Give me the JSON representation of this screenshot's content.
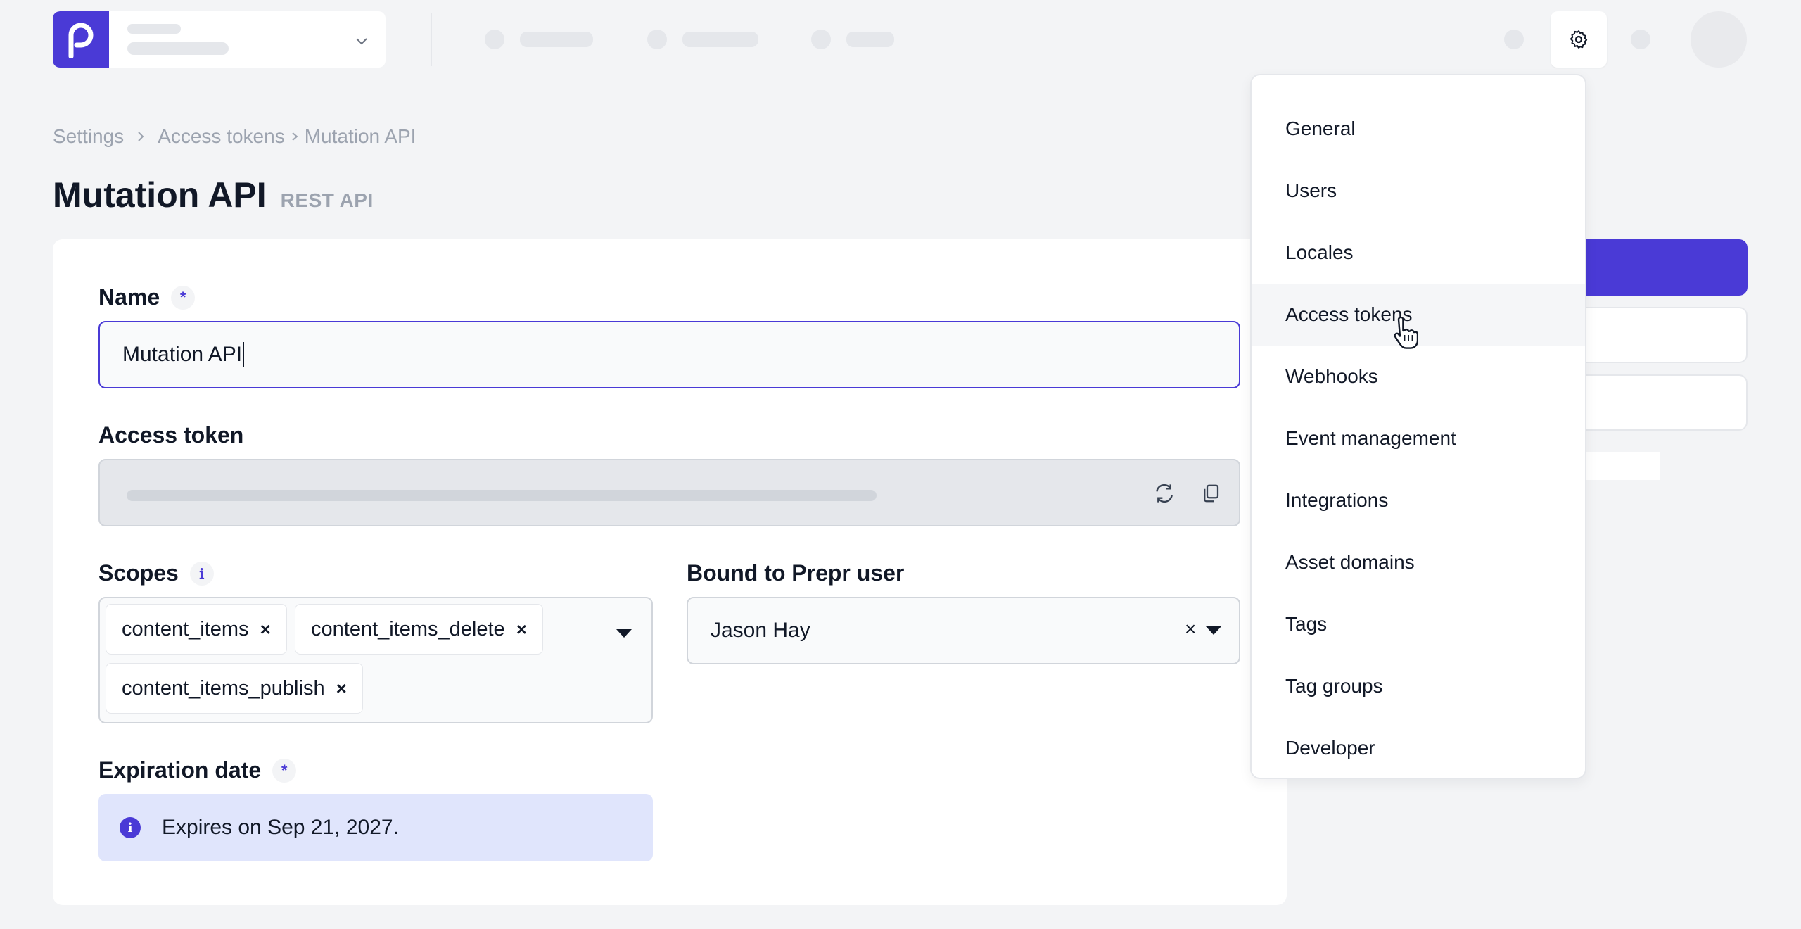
{
  "topbar": {
    "brand_color": "#4a3ad6",
    "logo_letter": "p",
    "settings_icon": "gear-icon"
  },
  "breadcrumb": {
    "items": [
      "Settings",
      "Access tokens",
      "Mutation API"
    ]
  },
  "page": {
    "title": "Mutation API",
    "subtitle": "REST API"
  },
  "form": {
    "name_label": "Name",
    "name_required_mark": "*",
    "name_value": "Mutation API",
    "access_token_label": "Access token",
    "scopes_label": "Scopes",
    "scopes_info_mark": "i",
    "scopes": [
      "content_items",
      "content_items_delete",
      "content_items_publish"
    ],
    "chip_remove_mark": "×",
    "bound_user_label": "Bound to Prepr user",
    "bound_user_value": "Jason Hay",
    "clear_mark": "×",
    "expiration_label": "Expiration date",
    "expiration_required_mark": "*",
    "expiration_info_mark": "i",
    "expiration_text": "Expires on Sep 21, 2027."
  },
  "settings_menu": {
    "items": [
      "General",
      "Users",
      "Locales",
      "Access tokens",
      "Webhooks",
      "Event management",
      "Integrations",
      "Asset domains",
      "Tags",
      "Tag groups",
      "Developer"
    ],
    "active": "Access tokens"
  }
}
